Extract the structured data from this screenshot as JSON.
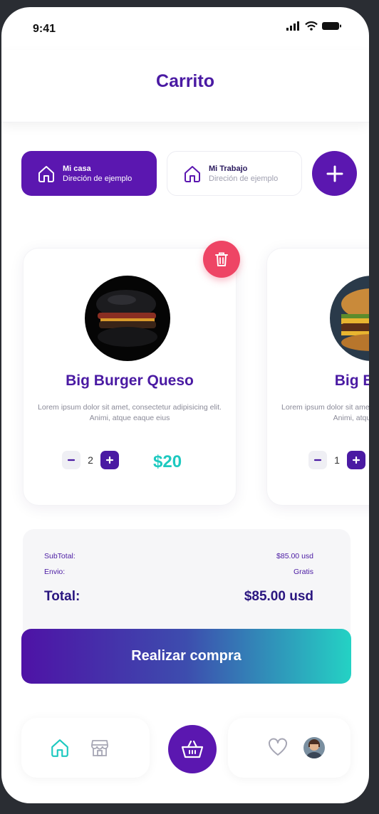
{
  "status_bar": {
    "time": "9:41"
  },
  "header": {
    "title": "Carrito"
  },
  "addresses": [
    {
      "title": "Mi casa",
      "subtitle": "Direción de ejemplo",
      "selected": true
    },
    {
      "title": "Mi Trabajo",
      "subtitle": "Direción de ejemplo",
      "selected": false
    }
  ],
  "products": [
    {
      "name": "Big Burger Queso",
      "description": "Lorem ipsum dolor sit amet, consectetur adipisicing elit. Animi, atque eaque eius",
      "quantity": "2",
      "price": "$20"
    },
    {
      "name": "Big Burger",
      "description": "Lorem ipsum dolor sit amet, consectetur adipisicing elit. Animi, atque eaque eius",
      "quantity": "1",
      "price": ""
    }
  ],
  "summary": {
    "subtotal_label": "SubTotal:",
    "subtotal_value": "$85.00 usd",
    "shipping_label": "Envio:",
    "shipping_value": "Gratis",
    "total_label": "Total:",
    "total_value": "$85.00 usd"
  },
  "buy_button": "Realizar compra",
  "colors": {
    "primary": "#5b17b0",
    "title": "#4a1aa3",
    "accent": "#1ec9c0",
    "danger": "#ee4565"
  },
  "nav": {
    "items": [
      "home-icon",
      "store-icon",
      "basket-icon",
      "heart-icon",
      "avatar"
    ],
    "active": "home-icon"
  }
}
